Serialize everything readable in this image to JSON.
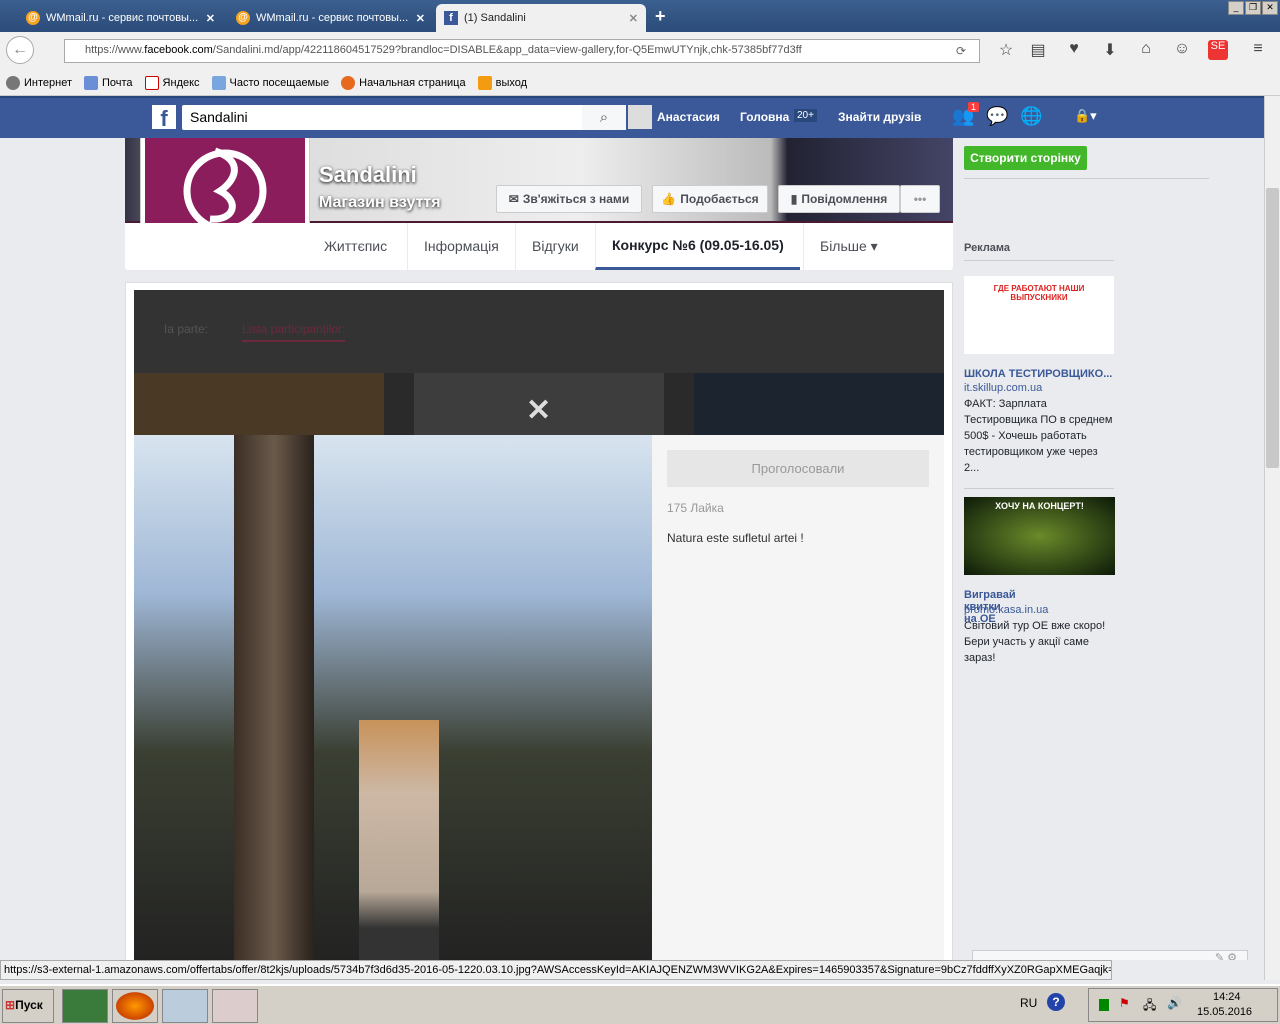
{
  "browser": {
    "tabs": [
      {
        "title": "WMmail.ru - сервис почтовы..."
      },
      {
        "title": "WMmail.ru - сервис почтовы..."
      },
      {
        "title": "(1) Sandalini"
      }
    ],
    "url_prefix": "https://www.",
    "url_domain": "facebook.com",
    "url_rest": "/Sandalini.md/app/422118604517529?brandloc=DISABLE&app_data=view-gallery,for-Q5EmwUTYnjk,chk-57385bf77d3ff",
    "bookmarks": [
      "Интернет",
      "Почта",
      "Яндекс",
      "Часто посещаемые",
      "Начальная страница",
      "выход"
    ],
    "status_url": "https://s3-external-1.amazonaws.com/offertabs/offer/8t2kjs/uploads/5734b7f3d6d35-2016-05-1220.03.10.jpg?AWSAccessKeyId=AKIAJQENZWM3WVIKG2A&Expires=1465903357&Signature=9bCz7fddffXyXZ0RGapXMEGaqjk="
  },
  "facebook": {
    "search_value": "Sandalini",
    "user": "Анастасия",
    "home": "Головна",
    "home_badge": "20+",
    "find_friends": "Знайти друзів",
    "friend_badge": "1"
  },
  "page": {
    "name": "Sandalini",
    "category": "Магазин взуття",
    "buttons": {
      "contact": "Зв'яжіться з нами",
      "like": "Подобається",
      "message": "Повідомлення",
      "more": "•••"
    },
    "tabs": [
      "Життєпис",
      "Інформація",
      "Відгуки",
      "Конкурс №6 (09.05-16.05)",
      "Більше ▾"
    ]
  },
  "app": {
    "nav_label": "Ia parte:",
    "nav_link": "Lista participanților:",
    "voted_button": "Проголосовали",
    "likes": "175 Лайка",
    "caption": "Natura este sufletul artei !"
  },
  "sidebar": {
    "create_page": "Створити сторінку",
    "ads_title": "Реклама",
    "ad1_banner": "ГДЕ РАБОТАЮТ НАШИ ВЫПУСКНИКИ",
    "ads": [
      {
        "title": "ШКОЛА ТЕСТИРОВЩИКО...",
        "site": "it.skillup.com.ua",
        "body": "ФАКТ: Зарплата Тестировщика ПО в среднем 500$ - Хочешь работать тестировщиком уже через 2..."
      },
      {
        "title": "Вигравай квитки на ОЕ",
        "site": "promo.kasa.in.ua",
        "body": "Світовий тур ОЕ вже скоро! Бери участь у акції саме зараз!",
        "banner": "ХОЧУ НА КОНЦЕРТ!"
      }
    ]
  },
  "taskbar": {
    "start": "Пуск",
    "lang": "RU",
    "time": "14:24",
    "date": "15.05.2016"
  }
}
